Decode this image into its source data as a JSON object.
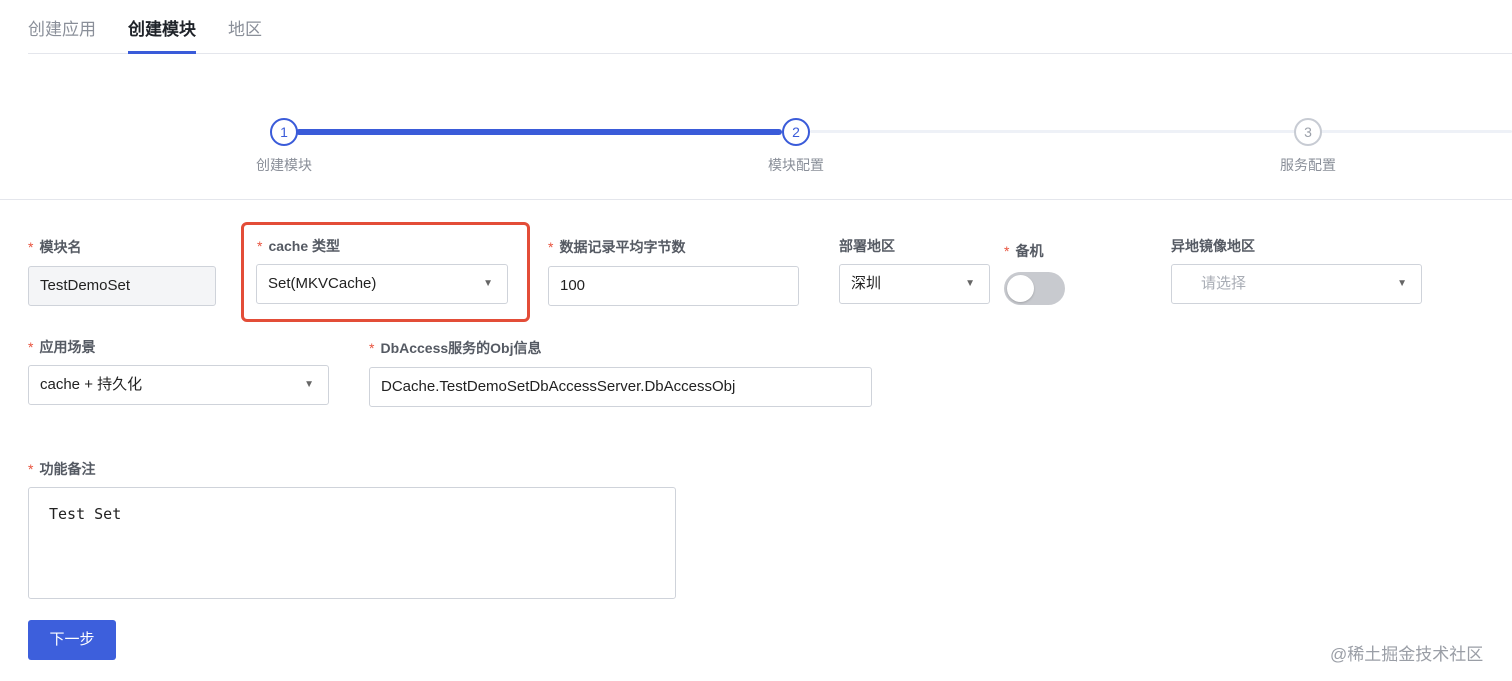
{
  "tabs": [
    "创建应用",
    "创建模块",
    "地区"
  ],
  "active_tab": "创建模块",
  "steps": [
    {
      "num": "1",
      "label": "创建模块",
      "status": "done"
    },
    {
      "num": "2",
      "label": "模块配置",
      "status": "active"
    },
    {
      "num": "3",
      "label": "服务配置",
      "status": "pending"
    }
  ],
  "form": {
    "required_mark": "*",
    "module_name": {
      "label": "模块名",
      "value": "TestDemoSet"
    },
    "cache_type": {
      "label": "cache 类型",
      "value": "Set(MKVCache)"
    },
    "avg_record_bytes": {
      "label": "数据记录平均字节数",
      "value": "100"
    },
    "deploy_region": {
      "label": "部署地区",
      "value": "深圳"
    },
    "standby": {
      "label": "备机",
      "on": false
    },
    "mirror_region": {
      "label": "异地镜像地区",
      "placeholder": "请选择"
    },
    "scenario": {
      "label": "应用场景",
      "value": "cache + 持久化"
    },
    "dbaccess_obj": {
      "label": "DbAccess服务的Obj信息",
      "value": "DCache.TestDemoSetDbAccessServer.DbAccessObj"
    },
    "remark": {
      "label": "功能备注",
      "value": "Test Set"
    }
  },
  "buttons": {
    "next": "下一步"
  },
  "watermark": "@稀土掘金技术社区",
  "colors": {
    "primary": "#3a5bd9",
    "highlight": "#e34d38",
    "required": "#e8533e"
  }
}
